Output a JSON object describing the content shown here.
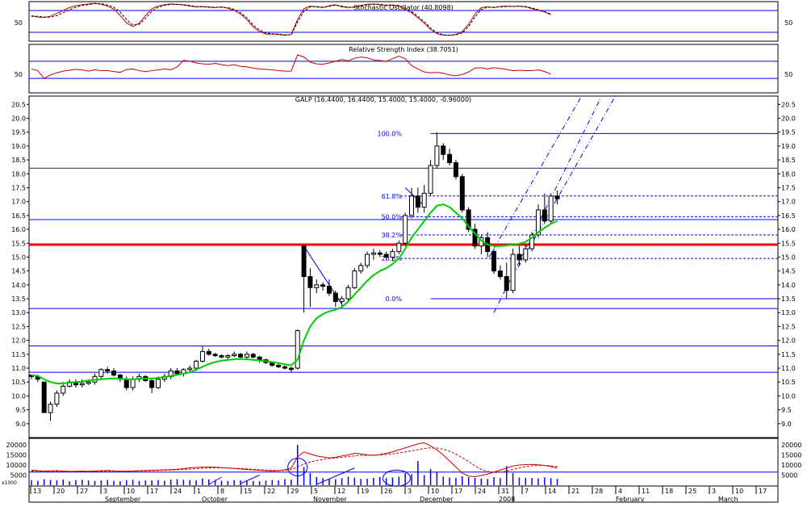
{
  "chart_data": {
    "type": "candlestick",
    "colors": {
      "background": "#ffffff",
      "frame": "#000000",
      "guide_line": "#0000ff",
      "signal": "#cc0000",
      "moving_average": "#00cc00",
      "support": "#ff0000"
    },
    "stochastic": {
      "title": "Stochastic Oscillator (40.8098)",
      "ytick_labels": [
        "50"
      ],
      "ylim": [
        0,
        100
      ],
      "levels": [
        20,
        80
      ],
      "k": [
        66,
        62,
        61,
        64,
        72,
        80,
        88,
        93,
        96,
        98,
        100,
        97,
        92,
        84,
        66,
        46,
        36,
        45,
        66,
        85,
        92,
        96,
        98,
        97,
        95,
        92,
        90,
        91,
        89,
        88,
        90,
        86,
        80,
        70,
        55,
        35,
        22,
        15,
        15,
        14,
        12,
        14,
        55,
        85,
        92,
        90,
        88,
        93,
        96,
        90,
        88,
        90,
        94,
        97,
        98,
        96,
        94,
        95,
        92,
        82,
        74,
        60,
        45,
        28,
        16,
        12,
        12,
        14,
        22,
        42,
        70,
        88,
        90,
        88,
        91,
        92,
        91,
        92,
        90,
        85,
        80,
        76,
        68
      ],
      "d": [
        64,
        64,
        62,
        62,
        66,
        74,
        82,
        89,
        94,
        96,
        99,
        99,
        95,
        89,
        76,
        55,
        40,
        42,
        58,
        78,
        89,
        94,
        97,
        97,
        96,
        94,
        91,
        90,
        90,
        89,
        89,
        88,
        83,
        74,
        60,
        40,
        26,
        18,
        16,
        15,
        13,
        13,
        48,
        78,
        90,
        91,
        89,
        91,
        95,
        92,
        89,
        89,
        92,
        96,
        97,
        97,
        95,
        95,
        94,
        86,
        77,
        64,
        49,
        32,
        19,
        13,
        12,
        13,
        18,
        36,
        62,
        83,
        89,
        89,
        90,
        91,
        91,
        92,
        91,
        87,
        82,
        77,
        70
      ]
    },
    "rsi": {
      "title": "Relative Strength Index (38.7051)",
      "ytick_labels": [
        "50"
      ],
      "ylim": [
        0,
        100
      ],
      "levels": [
        30,
        70
      ],
      "values": [
        52,
        48,
        30,
        38,
        43,
        47,
        49,
        51,
        50,
        47,
        50,
        48,
        48,
        46,
        44,
        51,
        52,
        48,
        46,
        48,
        50,
        52,
        50,
        57,
        72,
        70,
        66,
        64,
        63,
        65,
        62,
        60,
        62,
        58,
        57,
        54,
        52,
        51,
        50,
        48,
        47,
        47,
        85,
        80,
        68,
        64,
        63,
        66,
        70,
        74,
        71,
        77,
        80,
        78,
        73,
        72,
        70,
        76,
        82,
        76,
        60,
        52,
        45,
        43,
        44,
        42,
        38,
        36,
        39,
        45,
        54,
        55,
        52,
        55,
        53,
        51,
        48,
        49,
        48,
        48,
        50,
        46,
        40
      ]
    },
    "price": {
      "title": "GALP (16.4400, 16.4400, 15.4000, 15.4000, -0.96000)",
      "ylim": [
        8.5,
        20.8
      ],
      "ytick_labels": [
        "9.0",
        "9.5",
        "10.0",
        "10.5",
        "11.0",
        "11.5",
        "12.0",
        "12.5",
        "13.0",
        "13.5",
        "14.0",
        "14.5",
        "15.0",
        "15.5",
        "16.0",
        "16.5",
        "17.0",
        "17.5",
        "18.0",
        "18.5",
        "19.0",
        "19.5",
        "20.0",
        "20.5"
      ],
      "x_labels": [
        "13",
        "20",
        "27",
        "3",
        "10",
        "17",
        "24",
        "1",
        "8",
        "15",
        "22",
        "29",
        "5",
        "12",
        "19",
        "26",
        "3",
        "10",
        "17",
        "24",
        "31",
        "7",
        "14",
        "21",
        "28",
        "4",
        "11",
        "18",
        "25",
        "3",
        "10",
        "17"
      ],
      "month_labels": [
        "September",
        "October",
        "November",
        "December",
        "February",
        "March"
      ],
      "year_label": "2008",
      "ohlc": [
        [
          10.75,
          10.75,
          10.6,
          10.7
        ],
        [
          10.7,
          10.7,
          10.5,
          10.6
        ],
        [
          10.5,
          10.5,
          9.4,
          9.4
        ],
        [
          9.4,
          9.8,
          9.1,
          9.7
        ],
        [
          9.7,
          10.2,
          9.6,
          10.1
        ],
        [
          10.1,
          10.5,
          10.0,
          10.35
        ],
        [
          10.35,
          10.6,
          10.3,
          10.5
        ],
        [
          10.5,
          10.6,
          10.3,
          10.4
        ],
        [
          10.4,
          10.6,
          10.3,
          10.45
        ],
        [
          10.45,
          10.6,
          10.4,
          10.5
        ],
        [
          10.5,
          10.8,
          10.4,
          10.7
        ],
        [
          10.7,
          11.0,
          10.6,
          10.95
        ],
        [
          10.95,
          11.05,
          10.8,
          10.9
        ],
        [
          10.9,
          11.0,
          10.7,
          10.75
        ],
        [
          10.75,
          10.8,
          10.5,
          10.6
        ],
        [
          10.6,
          10.7,
          10.2,
          10.3
        ],
        [
          10.3,
          10.7,
          10.2,
          10.6
        ],
        [
          10.6,
          10.8,
          10.5,
          10.7
        ],
        [
          10.7,
          10.75,
          10.5,
          10.55
        ],
        [
          10.55,
          10.6,
          10.1,
          10.3
        ],
        [
          10.3,
          10.7,
          10.25,
          10.6
        ],
        [
          10.6,
          10.8,
          10.5,
          10.7
        ],
        [
          10.7,
          11.0,
          10.6,
          10.9
        ],
        [
          10.9,
          11.0,
          10.75,
          10.8
        ],
        [
          10.8,
          11.0,
          10.7,
          10.95
        ],
        [
          10.95,
          11.1,
          10.85,
          11.0
        ],
        [
          11.0,
          11.3,
          10.9,
          11.25
        ],
        [
          11.25,
          11.8,
          11.2,
          11.6
        ],
        [
          11.6,
          11.7,
          11.45,
          11.5
        ],
        [
          11.5,
          11.55,
          11.4,
          11.45
        ],
        [
          11.45,
          11.5,
          11.35,
          11.4
        ],
        [
          11.4,
          11.5,
          11.3,
          11.45
        ],
        [
          11.45,
          11.6,
          11.4,
          11.5
        ],
        [
          11.5,
          11.55,
          11.35,
          11.4
        ],
        [
          11.4,
          11.6,
          11.3,
          11.5
        ],
        [
          11.5,
          11.55,
          11.35,
          11.4
        ],
        [
          11.4,
          11.45,
          11.2,
          11.3
        ],
        [
          11.3,
          11.35,
          11.15,
          11.2
        ],
        [
          11.2,
          11.25,
          11.05,
          11.1
        ],
        [
          11.1,
          11.15,
          11.0,
          11.05
        ],
        [
          11.05,
          11.1,
          10.95,
          11.0
        ],
        [
          11.0,
          11.05,
          10.85,
          10.95
        ],
        [
          11.0,
          12.4,
          10.95,
          12.35
        ],
        [
          15.4,
          15.4,
          13.0,
          14.3
        ],
        [
          14.3,
          14.6,
          13.2,
          13.9
        ],
        [
          13.9,
          14.2,
          13.7,
          14.0
        ],
        [
          14.0,
          14.1,
          13.8,
          13.95
        ],
        [
          13.95,
          14.2,
          13.6,
          13.7
        ],
        [
          13.7,
          13.8,
          13.2,
          13.4
        ],
        [
          13.4,
          13.6,
          13.2,
          13.5
        ],
        [
          13.5,
          14.0,
          13.4,
          13.9
        ],
        [
          13.9,
          14.6,
          13.85,
          14.5
        ],
        [
          14.5,
          14.8,
          14.4,
          14.7
        ],
        [
          14.7,
          15.2,
          14.6,
          15.1
        ],
        [
          15.1,
          15.3,
          14.9,
          15.15
        ],
        [
          15.15,
          15.25,
          15.0,
          15.1
        ],
        [
          15.1,
          15.2,
          14.9,
          15.0
        ],
        [
          15.0,
          15.3,
          14.85,
          15.2
        ],
        [
          15.2,
          15.6,
          15.1,
          15.5
        ],
        [
          15.5,
          16.6,
          15.4,
          16.5
        ],
        [
          16.5,
          17.5,
          16.4,
          17.2
        ],
        [
          17.2,
          17.5,
          16.6,
          16.8
        ],
        [
          16.8,
          17.6,
          16.6,
          17.3
        ],
        [
          17.3,
          18.5,
          17.2,
          18.3
        ],
        [
          18.3,
          19.5,
          18.2,
          19.0
        ],
        [
          19.0,
          19.1,
          18.5,
          18.7
        ],
        [
          18.7,
          18.9,
          18.3,
          18.4
        ],
        [
          18.4,
          18.5,
          17.8,
          17.9
        ],
        [
          17.9,
          18.0,
          16.6,
          16.7
        ],
        [
          16.7,
          16.8,
          15.9,
          16.0
        ],
        [
          16.0,
          16.2,
          15.3,
          15.4
        ],
        [
          15.4,
          15.8,
          15.1,
          15.7
        ],
        [
          15.7,
          15.9,
          15.0,
          15.2
        ],
        [
          15.2,
          15.3,
          14.4,
          14.5
        ],
        [
          14.5,
          14.7,
          14.2,
          14.3
        ],
        [
          14.3,
          14.8,
          13.5,
          13.8
        ],
        [
          13.8,
          15.3,
          13.7,
          15.1
        ],
        [
          15.1,
          15.4,
          14.7,
          14.9
        ],
        [
          14.9,
          15.5,
          14.8,
          15.3
        ],
        [
          15.3,
          15.9,
          15.2,
          15.8
        ],
        [
          15.8,
          16.9,
          15.7,
          16.7
        ],
        [
          16.7,
          17.3,
          16.2,
          16.3
        ],
        [
          16.3,
          17.3,
          16.2,
          17.2
        ],
        [
          17.2,
          17.4,
          16.9,
          17.1
        ]
      ],
      "ma": [
        10.75,
        10.72,
        10.6,
        10.5,
        10.45,
        10.45,
        10.48,
        10.5,
        10.52,
        10.55,
        10.58,
        10.6,
        10.62,
        10.63,
        10.62,
        10.6,
        10.6,
        10.62,
        10.63,
        10.63,
        10.65,
        10.68,
        10.72,
        10.76,
        10.8,
        10.85,
        10.95,
        11.05,
        11.15,
        11.22,
        11.27,
        11.3,
        11.32,
        11.33,
        11.32,
        11.3,
        11.28,
        11.25,
        11.22,
        11.18,
        11.14,
        11.1,
        11.3,
        12.0,
        12.5,
        12.8,
        12.95,
        13.05,
        13.1,
        13.2,
        13.4,
        13.65,
        13.9,
        14.15,
        14.35,
        14.5,
        14.6,
        14.75,
        14.95,
        15.3,
        15.7,
        16.0,
        16.3,
        16.6,
        16.85,
        16.9,
        16.8,
        16.6,
        16.4,
        16.1,
        15.85,
        15.6,
        15.45,
        15.4,
        15.4,
        15.42,
        15.45,
        15.48,
        15.55,
        15.7,
        15.9,
        16.05,
        16.2,
        16.3
      ],
      "horizontal_levels": [
        10.85,
        11.8,
        13.15,
        16.35,
        18.2
      ],
      "support_level": 15.45,
      "fib_levels": [
        {
          "label": "100.0%",
          "value": 19.45
        },
        {
          "label": "61.8%",
          "value": 17.2
        },
        {
          "label": "50.0%",
          "value": 16.45
        },
        {
          "label": "38.2%",
          "value": 15.8
        },
        {
          "label": "23.6%",
          "value": 14.95
        },
        {
          "label": "0.0%",
          "value": 13.5
        }
      ]
    },
    "volume": {
      "ytick_labels": [
        "5000",
        "10000",
        "15000",
        "20000"
      ],
      "units_label": "x1000",
      "ylim": [
        0,
        22000
      ],
      "reference_level": 6500,
      "values": [
        2500,
        2200,
        3000,
        2600,
        2400,
        2800,
        1900,
        2500,
        2700,
        2300,
        2100,
        2400,
        2600,
        2200,
        2000,
        2500,
        2700,
        2100,
        2300,
        2400,
        2600,
        2200,
        2800,
        3000,
        2700,
        2600,
        2400,
        3300,
        2900,
        2600,
        2200,
        2100,
        2500,
        2400,
        2300,
        2100,
        2000,
        2300,
        2600,
        2400,
        3000,
        2800,
        20000,
        9000,
        6000,
        4000,
        3500,
        3200,
        3000,
        3500,
        4200,
        3800,
        3100,
        3200,
        3600,
        4000,
        3500,
        3800,
        4200,
        6000,
        5500,
        12000,
        5000,
        8000,
        6800,
        4200,
        3800,
        3700,
        4400,
        3900,
        3600,
        3300,
        3100,
        4000,
        3500,
        9500,
        6000,
        3800,
        3700,
        3600,
        3400,
        3900,
        3500,
        3100
      ],
      "fast": [
        7500,
        7200,
        7000,
        7100,
        7200,
        7000,
        6800,
        6900,
        7000,
        6900,
        7000,
        7200,
        7300,
        7100,
        7000,
        6900,
        7000,
        7200,
        7300,
        7400,
        7500,
        7600,
        7700,
        7900,
        8200,
        8600,
        8800,
        8900,
        9000,
        8900,
        8700,
        8500,
        8300,
        8000,
        7800,
        7600,
        7400,
        7200,
        7100,
        7200,
        7600,
        8500,
        14000,
        16500,
        15500,
        14500,
        14000,
        13500,
        13800,
        14500,
        15000,
        15800,
        15500,
        15000,
        14800,
        15200,
        15800,
        16500,
        17500,
        18500,
        19500,
        20500,
        21000,
        19500,
        17500,
        15000,
        12000,
        9000,
        6000,
        4500,
        4200,
        4800,
        5500,
        6500,
        7500,
        8500,
        9500,
        10000,
        10200,
        10300,
        10100,
        9800,
        9200,
        8500
      ],
      "slow": [
        7000,
        7000,
        6900,
        6900,
        6900,
        6900,
        6900,
        6800,
        6800,
        6800,
        6800,
        6900,
        7000,
        7000,
        7000,
        7000,
        7000,
        7100,
        7100,
        7200,
        7300,
        7400,
        7500,
        7600,
        7800,
        8000,
        8200,
        8400,
        8500,
        8600,
        8600,
        8500,
        8400,
        8300,
        8100,
        7900,
        7700,
        7500,
        7400,
        7300,
        7400,
        7700,
        9000,
        10500,
        11500,
        12200,
        12800,
        13200,
        13500,
        13800,
        14200,
        14500,
        14800,
        14800,
        14900,
        15000,
        15200,
        15500,
        16000,
        16500,
        17000,
        17600,
        18200,
        18500,
        18400,
        17800,
        16800,
        15400,
        13600,
        11800,
        9600,
        7800,
        6800,
        6300,
        6400,
        7000,
        7800,
        8600,
        9200,
        9600,
        9800,
        9800,
        9600,
        9200
      ]
    }
  }
}
